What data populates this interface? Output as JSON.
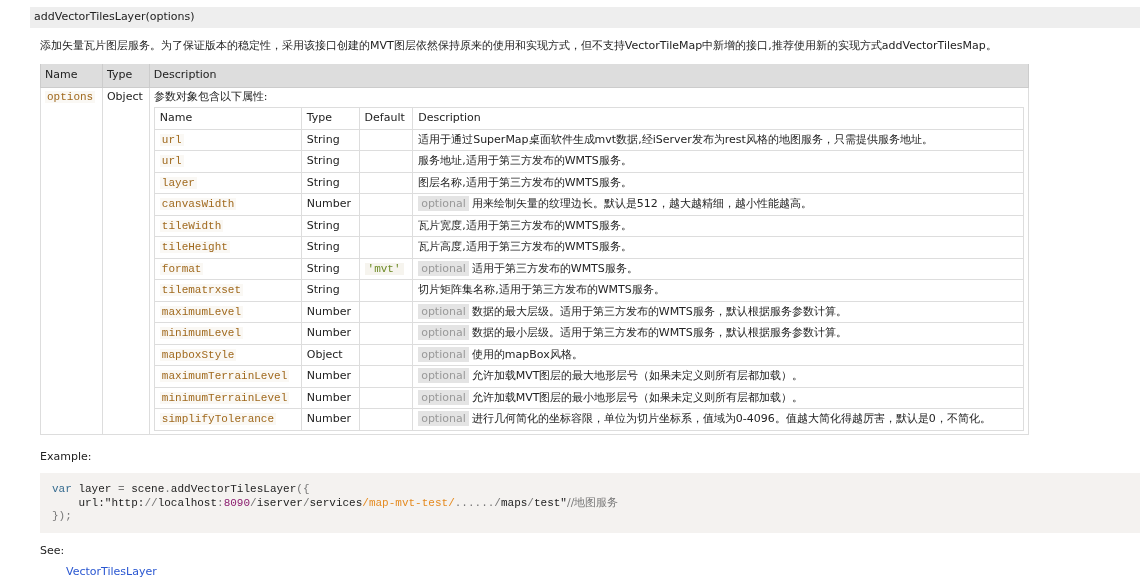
{
  "signature": "addVectorTilesLayer(options)",
  "summary": "添加矢量瓦片图层服务。为了保证版本的稳定性，采用该接口创建的MVT图层依然保持原来的使用和实现方式，但不支持VectorTileMap中新增的接口,推荐使用新的实现方式addVectorTilesMap。",
  "params_table": {
    "columns": [
      "Name",
      "Type",
      "Description"
    ],
    "rows": [
      {
        "name": "options",
        "type": "Object",
        "description": "参数对象包含以下属性:",
        "properties": {
          "columns": [
            "Name",
            "Type",
            "Default",
            "Description"
          ],
          "rows": [
            {
              "name": "url",
              "type": "String",
              "description": "适用于通过SuperMap桌面软件生成mvt数据,经iServer发布为rest风格的地图服务，只需提供服务地址。"
            },
            {
              "name": "url",
              "type": "String",
              "description": "服务地址,适用于第三方发布的WMTS服务。"
            },
            {
              "name": "layer",
              "type": "String",
              "description": "图层名称,适用于第三方发布的WMTS服务。"
            },
            {
              "name": "canvasWidth",
              "type": "Number",
              "optional_label": "optional",
              "description": "用来绘制矢量的纹理边长。默认是512，越大越精细，越小性能越高。"
            },
            {
              "name": "tileWidth",
              "type": "String",
              "description": "瓦片宽度,适用于第三方发布的WMTS服务。"
            },
            {
              "name": "tileHeight",
              "type": "String",
              "description": "瓦片高度,适用于第三方发布的WMTS服务。"
            },
            {
              "name": "format",
              "type": "String",
              "default": "'mvt'",
              "optional_label": "optional",
              "description": "适用于第三方发布的WMTS服务。"
            },
            {
              "name": "tilematrxset",
              "type": "String",
              "description": "切片矩阵集名称,适用于第三方发布的WMTS服务。"
            },
            {
              "name": "maximumLevel",
              "type": "Number",
              "optional_label": "optional",
              "description": "数据的最大层级。适用于第三方发布的WMTS服务，默认根据服务参数计算。"
            },
            {
              "name": "minimumLevel",
              "type": "Number",
              "optional_label": "optional",
              "description": "数据的最小层级。适用于第三方发布的WMTS服务，默认根据服务参数计算。"
            },
            {
              "name": "mapboxStyle",
              "type": "Object",
              "optional_label": "optional",
              "description": "使用的mapBox风格。"
            },
            {
              "name": "maximumTerrainLevel",
              "type": "Number",
              "optional_label": "optional",
              "description": "允许加载MVT图层的最大地形层号（如果未定义则所有层都加载）。"
            },
            {
              "name": "minimumTerrainLevel",
              "type": "Number",
              "optional_label": "optional",
              "description": "允许加载MVT图层的最小地形层号（如果未定义则所有层都加载）。"
            },
            {
              "name": "simplifyTolerance",
              "type": "Number",
              "optional_label": "optional",
              "description": "进行几何简化的坐标容限，单位为切片坐标系，值域为0-4096。值越大简化得越厉害，默认是0，不简化。"
            }
          ]
        }
      }
    ]
  },
  "example_label": "Example:",
  "code_lines": [
    [
      {
        "kind": "keyword",
        "text": "var"
      },
      {
        "kind": "plain",
        "text": " layer "
      },
      {
        "kind": "punct",
        "text": "="
      },
      {
        "kind": "plain",
        "text": " scene"
      },
      {
        "kind": "punct",
        "text": "."
      },
      {
        "kind": "plain",
        "text": "addVectorTilesLayer"
      },
      {
        "kind": "punct",
        "text": "({"
      }
    ],
    [
      {
        "kind": "plain",
        "text": "    url:\"http:"
      },
      {
        "kind": "punct",
        "text": "//"
      },
      {
        "kind": "plain",
        "text": "localhost"
      },
      {
        "kind": "punct",
        "text": ":"
      },
      {
        "kind": "number",
        "text": "8090"
      },
      {
        "kind": "punct",
        "text": "/"
      },
      {
        "kind": "plain",
        "text": "iserver"
      },
      {
        "kind": "punct",
        "text": "/"
      },
      {
        "kind": "plain",
        "text": "services"
      },
      {
        "kind": "string",
        "text": "/map-mvt-test/"
      },
      {
        "kind": "punct",
        "text": "....../"
      },
      {
        "kind": "plain",
        "text": "maps"
      },
      {
        "kind": "punct",
        "text": "/"
      },
      {
        "kind": "plain",
        "text": "test\""
      },
      {
        "kind": "comment",
        "text": "//地图服务"
      }
    ],
    [
      {
        "kind": "punct",
        "text": "});"
      }
    ]
  ],
  "see_label": "See:",
  "see_links": [
    "VectorTilesLayer"
  ]
}
